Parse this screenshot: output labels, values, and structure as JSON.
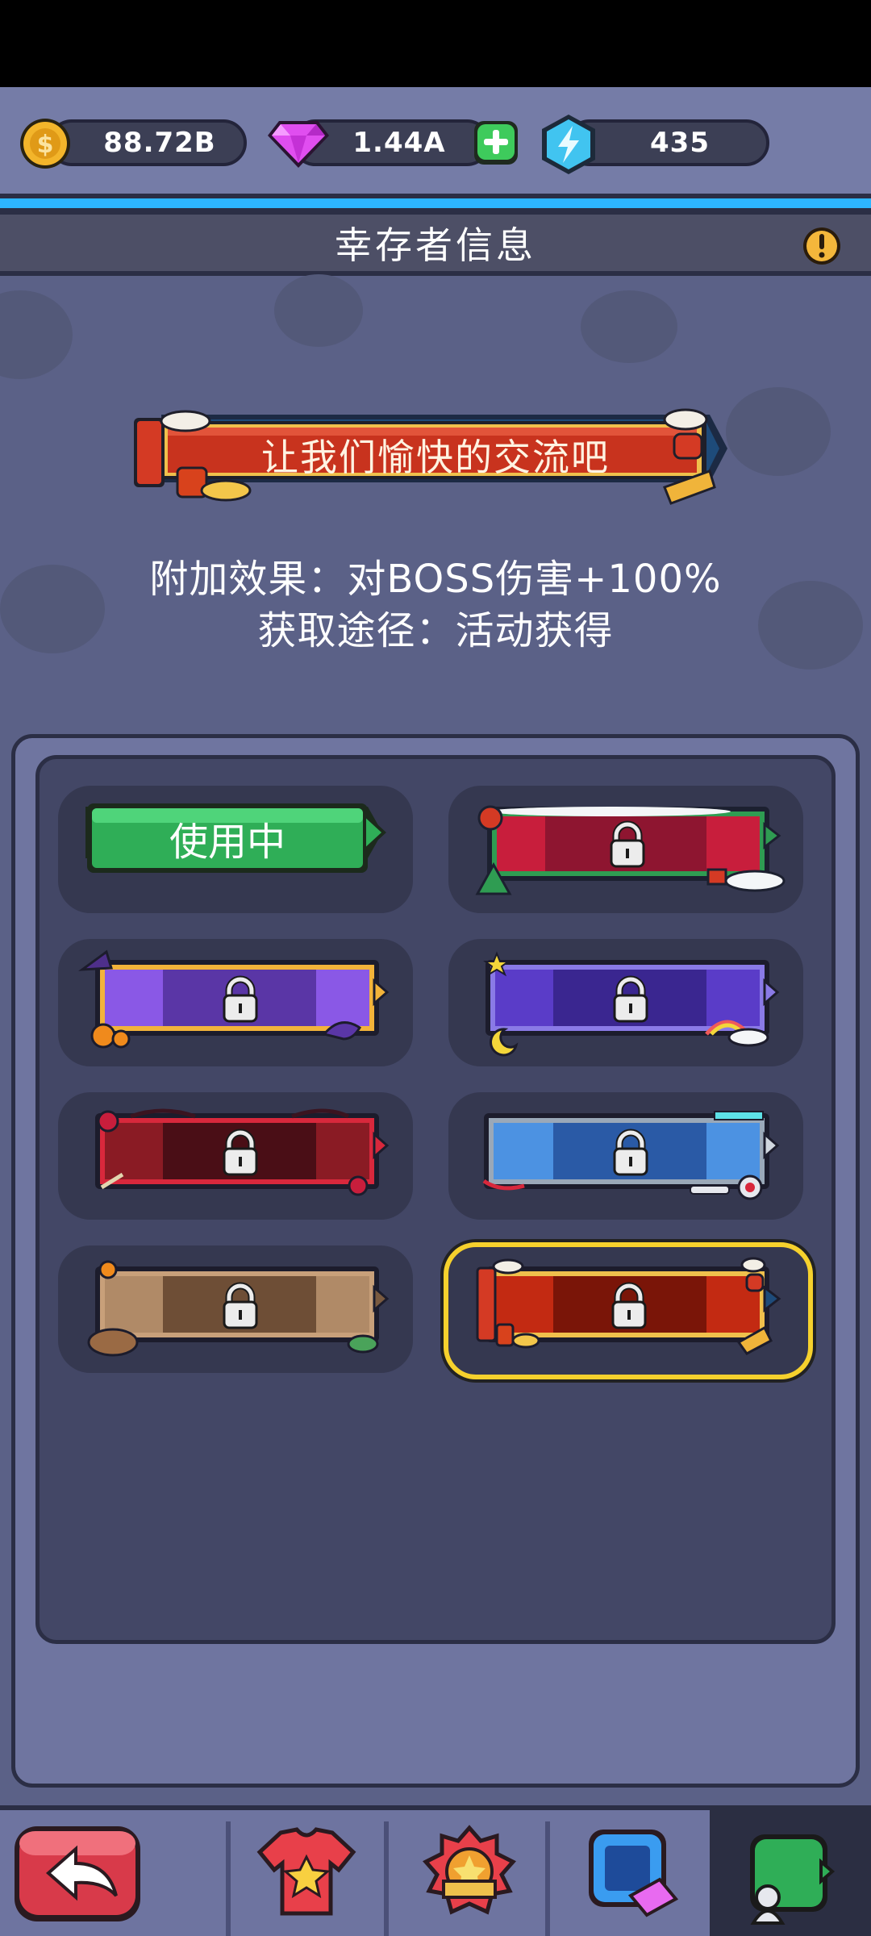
{
  "currency": {
    "coins": "88.72B",
    "gems": "1.44A",
    "energy": "435"
  },
  "header": {
    "title": "幸存者信息"
  },
  "banner": {
    "text": "让我们愉快的交流吧"
  },
  "effect": {
    "bonus": "附加效果：对BOSS伤害+100%",
    "source": "获取途径：活动获得"
  },
  "frames": [
    {
      "id": "default-green",
      "label": "使用中",
      "locked": false,
      "color": "#2fae57"
    },
    {
      "id": "christmas-red",
      "locked": true,
      "color": "#c81e3c"
    },
    {
      "id": "halloween-purple",
      "locked": true,
      "color": "#7b4bd6"
    },
    {
      "id": "night-sky-indigo",
      "locked": true,
      "color": "#5a3cc8"
    },
    {
      "id": "rose-maroon",
      "locked": true,
      "color": "#8a1b24"
    },
    {
      "id": "tech-blue",
      "locked": true,
      "color": "#3f86d9"
    },
    {
      "id": "capybara-tan",
      "locked": true,
      "color": "#b08a67"
    },
    {
      "id": "newyear-red",
      "locked": true,
      "color": "#c32a12",
      "selected": true
    }
  ],
  "nav": {
    "tabs": [
      "back",
      "outfit",
      "badge",
      "avatar",
      "frame"
    ],
    "active": "frame"
  }
}
